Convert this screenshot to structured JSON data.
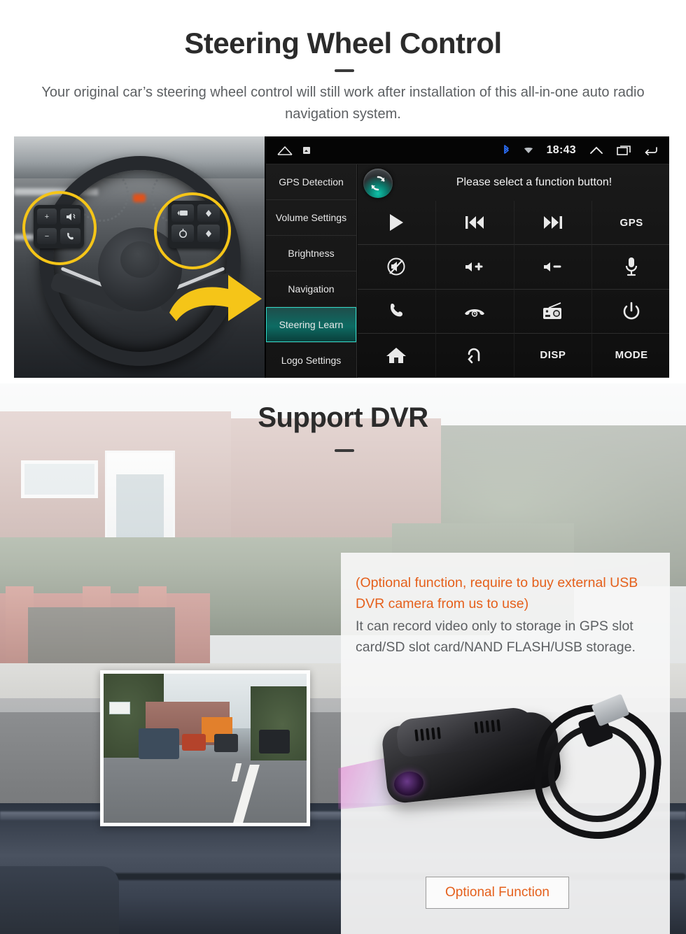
{
  "steering_section": {
    "title": "Steering Wheel Control",
    "subtitle": "Your original car’s steering wheel control will still work after installation of this all-in-one auto radio navigation system.",
    "photo_name": "steering-wheel-photo",
    "radio_screen": {
      "status_bar": {
        "home_icon": "home-icon",
        "app_icon": "app-icon",
        "bluetooth_icon": "bluetooth-icon",
        "wifi_icon": "wifi-icon",
        "time": "18:43",
        "chevron_up_icon": "chevron-up-icon",
        "recents_icon": "recent-apps-icon",
        "back_icon": "back-icon",
        "bluetooth_color": "#2b6df5"
      },
      "sidebar": [
        {
          "label": "GPS Detection",
          "active": false
        },
        {
          "label": "Volume Settings",
          "active": false
        },
        {
          "label": "Brightness",
          "active": false
        },
        {
          "label": "Navigation",
          "active": false
        },
        {
          "label": "Steering Learn",
          "active": true
        },
        {
          "label": "Logo Settings",
          "active": false
        }
      ],
      "active_color": "#0d6b63",
      "hint": "Please select a function button!",
      "sync_icon": "sync-refresh-icon",
      "buttons": [
        {
          "icon": "play-icon",
          "text": ""
        },
        {
          "icon": "previous-icon",
          "text": ""
        },
        {
          "icon": "next-icon",
          "text": ""
        },
        {
          "icon": "gps-label",
          "text": "GPS"
        },
        {
          "icon": "mute-icon",
          "text": ""
        },
        {
          "icon": "volume-up-icon",
          "text": ""
        },
        {
          "icon": "volume-down-icon",
          "text": ""
        },
        {
          "icon": "microphone-icon",
          "text": ""
        },
        {
          "icon": "phone-answer-icon",
          "text": ""
        },
        {
          "icon": "phone-hangup-icon",
          "text": ""
        },
        {
          "icon": "radio-icon",
          "text": ""
        },
        {
          "icon": "power-icon",
          "text": ""
        },
        {
          "icon": "home-icon",
          "text": ""
        },
        {
          "icon": "back-arrow-icon",
          "text": ""
        },
        {
          "icon": "disp-label",
          "text": "DISP"
        },
        {
          "icon": "mode-label",
          "text": "MODE"
        }
      ]
    }
  },
  "dvr_section": {
    "title": "Support DVR",
    "note": "(Optional function, require to buy external USB DVR camera from us to use)",
    "description": "It can record video only to storage in GPS slot card/SD slot card/NAND FLASH/USB storage.",
    "note_color": "#e5601c",
    "button_label": "Optional Function",
    "dashcam_inset_name": "dashcam-video-inset",
    "camera_name": "usb-dvr-camera-photo"
  }
}
